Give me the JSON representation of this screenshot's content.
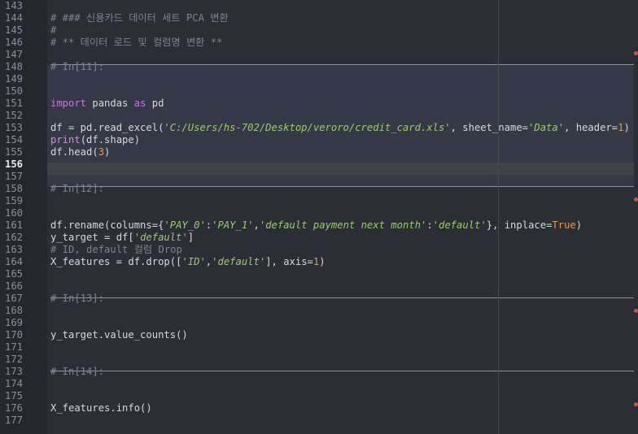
{
  "editor": {
    "lines": [
      {
        "n": "143",
        "text": ""
      },
      {
        "n": "144",
        "text": "# ### 신용카드 데이터 세트 PCA 변환"
      },
      {
        "n": "145",
        "text": "#"
      },
      {
        "n": "146",
        "text": "# ** 데이터 로드 및 컬럼명 변환 **"
      },
      {
        "n": "147",
        "text": ""
      },
      {
        "n": "148",
        "text": "# In[11]:"
      },
      {
        "n": "149",
        "text": ""
      },
      {
        "n": "150",
        "text": ""
      },
      {
        "n": "151",
        "text": "import pandas as pd"
      },
      {
        "n": "152",
        "text": ""
      },
      {
        "n": "153",
        "text": "df = pd.read_excel('C:/Users/hs-702/Desktop/veroro/credit_card.xls', sheet_name='Data', header=1)"
      },
      {
        "n": "154",
        "text": "print(df.shape)"
      },
      {
        "n": "155",
        "text": "df.head(3)"
      },
      {
        "n": "156",
        "text": ""
      },
      {
        "n": "157",
        "text": ""
      },
      {
        "n": "158",
        "text": "# In[12]:"
      },
      {
        "n": "159",
        "text": ""
      },
      {
        "n": "160",
        "text": ""
      },
      {
        "n": "161",
        "text": "df.rename(columns={'PAY_0':'PAY_1','default payment next month':'default'}, inplace=True)"
      },
      {
        "n": "162",
        "text": "y_target = df['default']"
      },
      {
        "n": "163",
        "text": "# ID, default 컬럼 Drop"
      },
      {
        "n": "164",
        "text": "X_features = df.drop(['ID','default'], axis=1)"
      },
      {
        "n": "165",
        "text": ""
      },
      {
        "n": "166",
        "text": ""
      },
      {
        "n": "167",
        "text": "# In[13]:"
      },
      {
        "n": "168",
        "text": ""
      },
      {
        "n": "169",
        "text": ""
      },
      {
        "n": "170",
        "text": "y_target.value_counts()"
      },
      {
        "n": "171",
        "text": ""
      },
      {
        "n": "172",
        "text": ""
      },
      {
        "n": "173",
        "text": "# In[14]:"
      },
      {
        "n": "174",
        "text": ""
      },
      {
        "n": "175",
        "text": ""
      },
      {
        "n": "176",
        "text": "X_features.info()"
      },
      {
        "n": "177",
        "text": ""
      }
    ],
    "current_line": "156",
    "tokens": {
      "l151": [
        "import",
        " pandas ",
        "as",
        " pd"
      ],
      "l153": [
        "df = pd.read_excel(",
        "'C:/Users/hs-702/Desktop/veroro/credit_card.xls'",
        ", sheet_name=",
        "'Data'",
        ", header=",
        "1",
        ")"
      ],
      "l154": [
        "print",
        "(df.shape)"
      ],
      "l155": [
        "df.head(",
        "3",
        ")"
      ],
      "l161": [
        "df.rename(columns={",
        "'PAY_0'",
        ":",
        "'PAY_1'",
        ",",
        "'default payment next month'",
        ":",
        "'default'",
        "}, inplace=",
        "True",
        ")"
      ],
      "l162": [
        "y_target = df[",
        "'default'",
        "]"
      ],
      "l164": [
        "X_features = df.drop([",
        "'ID'",
        ",",
        "'default'",
        "], axis=",
        "1",
        ")"
      ]
    }
  }
}
